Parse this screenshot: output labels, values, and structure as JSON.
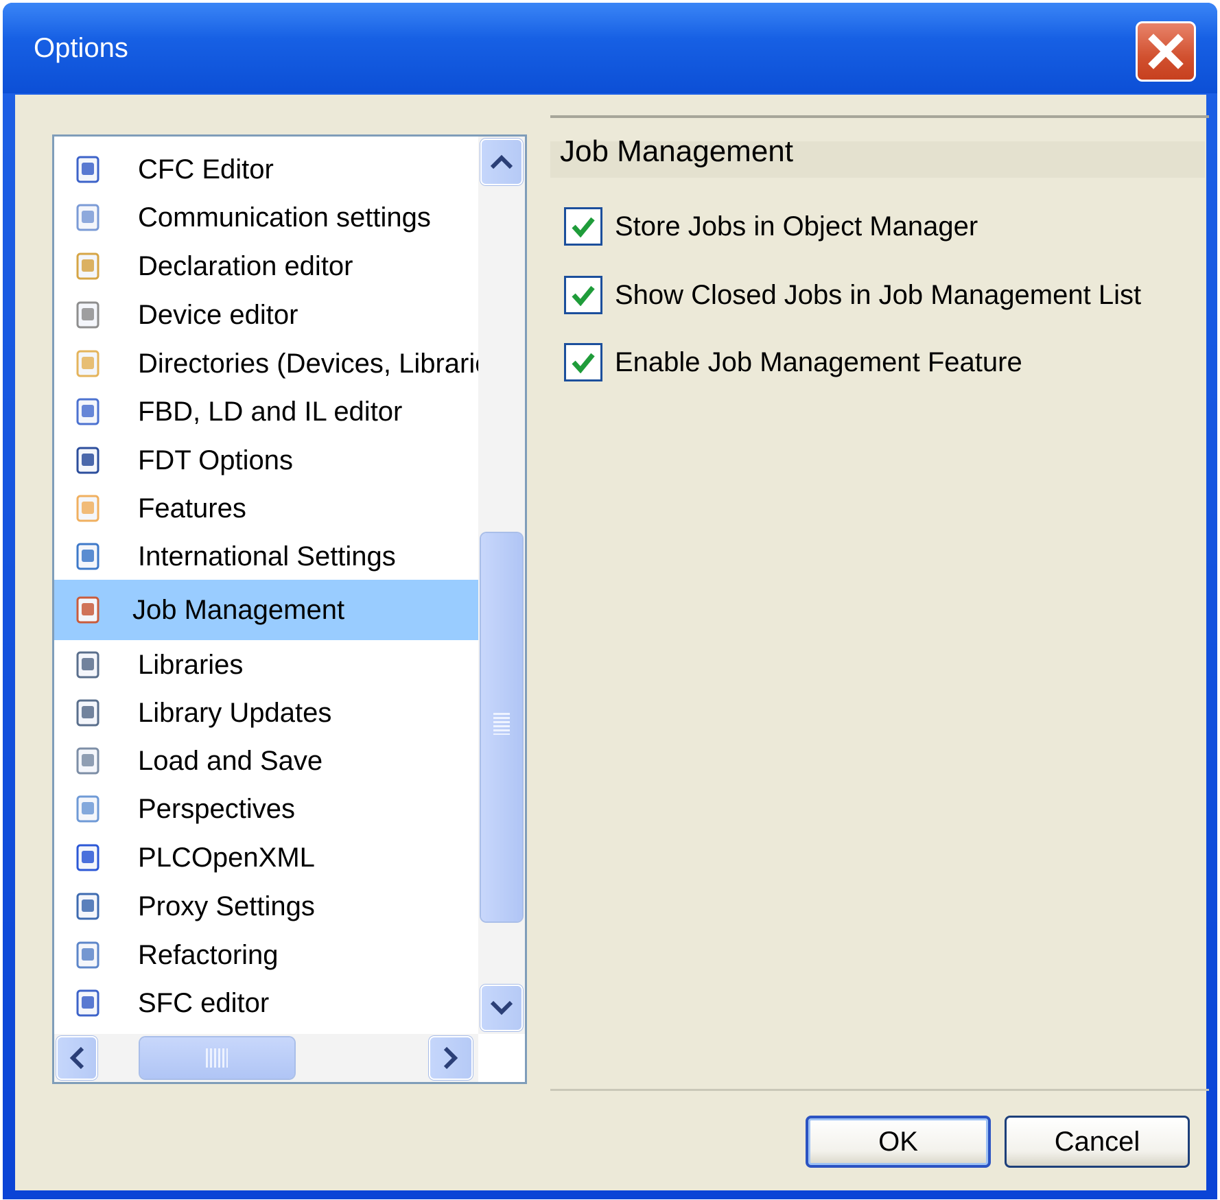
{
  "window": {
    "title": "Options"
  },
  "tree": {
    "items": [
      {
        "label": "CFC Editor",
        "icon": "cfc-editor-icon"
      },
      {
        "label": "Communication settings",
        "icon": "communication-icon"
      },
      {
        "label": "Declaration editor",
        "icon": "declaration-editor-icon"
      },
      {
        "label": "Device editor",
        "icon": "device-editor-icon"
      },
      {
        "label": "Directories (Devices, Libraries,",
        "icon": "folder-icon"
      },
      {
        "label": "FBD, LD and IL editor",
        "icon": "fbd-editor-icon"
      },
      {
        "label": "FDT Options",
        "icon": "fdt-icon"
      },
      {
        "label": "Features",
        "icon": "features-icon"
      },
      {
        "label": "International Settings",
        "icon": "globe-icon"
      },
      {
        "label": "Job Management",
        "icon": "clipboard-icon",
        "selected": true
      },
      {
        "label": "Libraries",
        "icon": "libraries-icon"
      },
      {
        "label": "Library Updates",
        "icon": "library-updates-icon"
      },
      {
        "label": "Load and Save",
        "icon": "load-save-icon"
      },
      {
        "label": "Perspectives",
        "icon": "perspectives-icon"
      },
      {
        "label": "PLCOpenXML",
        "icon": "plcopenxml-icon"
      },
      {
        "label": "Proxy Settings",
        "icon": "proxy-icon"
      },
      {
        "label": "Refactoring",
        "icon": "refactoring-icon"
      },
      {
        "label": "SFC editor",
        "icon": "sfc-editor-icon"
      }
    ]
  },
  "panel": {
    "title": "Job Management",
    "options": [
      {
        "label": "Store Jobs in Object Manager",
        "checked": true
      },
      {
        "label": "Show Closed Jobs in Job Management List",
        "checked": true
      },
      {
        "label": "Enable Job Management Feature",
        "checked": true
      }
    ]
  },
  "buttons": {
    "ok": "OK",
    "cancel": "Cancel"
  },
  "colors": {
    "titlebar": "#1760e4",
    "selection": "#99ccff",
    "client": "#ece9d8",
    "check": "#1f9c3a"
  }
}
